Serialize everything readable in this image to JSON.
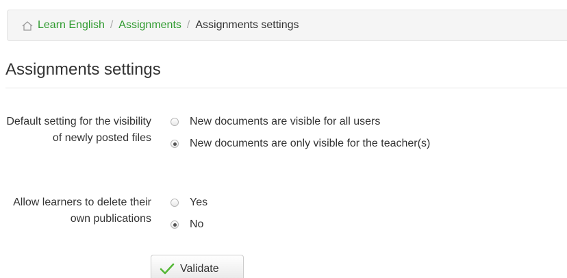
{
  "breadcrumb": {
    "items": [
      {
        "label": "Learn English"
      },
      {
        "label": "Assignments"
      }
    ],
    "separator": "/",
    "current": "Assignments settings"
  },
  "page": {
    "title": "Assignments settings"
  },
  "settings": {
    "visibility": {
      "label": "Default setting for the visibility of newly posted files",
      "options": [
        {
          "label": "New documents are visible for all users",
          "checked": false
        },
        {
          "label": "New documents are only visible for the teacher(s)",
          "checked": true
        }
      ]
    },
    "deletion": {
      "label": "Allow learners to delete their own publications",
      "options": [
        {
          "label": "Yes",
          "checked": false
        },
        {
          "label": "No",
          "checked": true
        }
      ]
    }
  },
  "actions": {
    "validate_label": "Validate"
  },
  "colors": {
    "link": "#2e9a2e",
    "check_icon": "#55b837"
  },
  "icons": {
    "home": "home-icon",
    "validate": "checkmark-icon"
  }
}
